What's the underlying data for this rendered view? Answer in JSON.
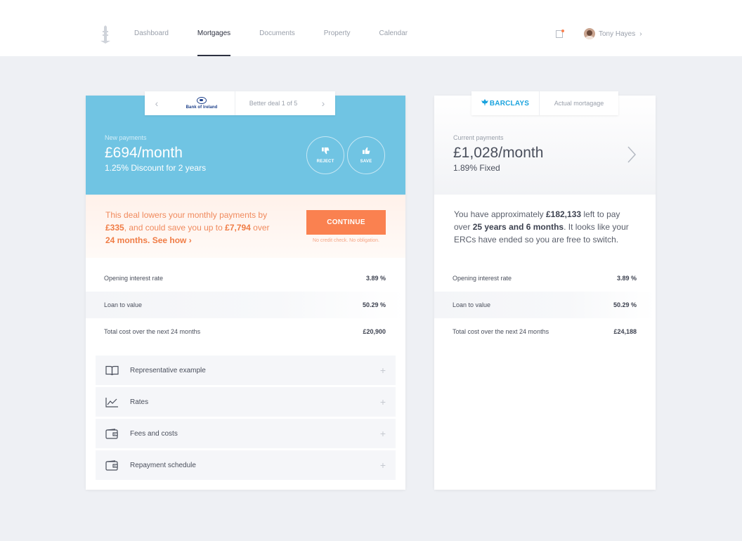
{
  "nav": {
    "items": [
      "Dashboard",
      "Mortgages",
      "Documents",
      "Property",
      "Calendar"
    ],
    "active_index": 1
  },
  "user": {
    "name": "Tony Hayes"
  },
  "colors": {
    "accent_blue": "#70c4e3",
    "accent_orange": "#fa8150",
    "barclays_blue": "#1aa3de"
  },
  "new_deal": {
    "bank_name": "Bank of Ireland",
    "deal_indicator": "Better deal 1 of 5",
    "caption": "New payments",
    "amount": "£694/month",
    "rate_text": "1.25% Discount for 2 years",
    "reject_label": "REJECT",
    "save_label": "SAVE",
    "promo": {
      "line_start": "This deal lowers your monthly payments by ",
      "saving_monthly": "£335",
      "line_mid": ", and could save you up to ",
      "saving_total": "£7,794",
      "line_end": " over ",
      "term": "24 months.",
      "see_how": "See how"
    },
    "continue_label": "CONTINUE",
    "continue_note": "No credit check. No obligation.",
    "rows": [
      {
        "label": "Opening interest rate",
        "value": "3.89 %"
      },
      {
        "label": "Loan to value",
        "value": "50.29 %"
      },
      {
        "label": "Total cost over the next 24 months",
        "value": "£20,900"
      }
    ],
    "accordion": [
      {
        "label": "Representative example",
        "icon": "book-icon"
      },
      {
        "label": "Rates",
        "icon": "line-chart-icon"
      },
      {
        "label": "Fees and costs",
        "icon": "wallet-icon"
      },
      {
        "label": "Repayment schedule",
        "icon": "wallet-icon"
      }
    ]
  },
  "current_deal": {
    "bank_name": "BARCLAYS",
    "tab_label": "Actual mortagage",
    "caption": "Current payments",
    "amount": "£1,028/month",
    "rate_text": "1.89% Fixed",
    "summary": {
      "part1": "You have approximately ",
      "balance": "£182,133",
      "part2": " left to pay over ",
      "term": "25 years and 6 months",
      "part3": ". It looks like your ERCs have ended so you are free to switch."
    },
    "rows": [
      {
        "label": "Opening interest rate",
        "value": "3.89 %"
      },
      {
        "label": "Loan to value",
        "value": "50.29 %"
      },
      {
        "label": "Total cost over the next 24 months",
        "value": "£24,188"
      }
    ]
  }
}
